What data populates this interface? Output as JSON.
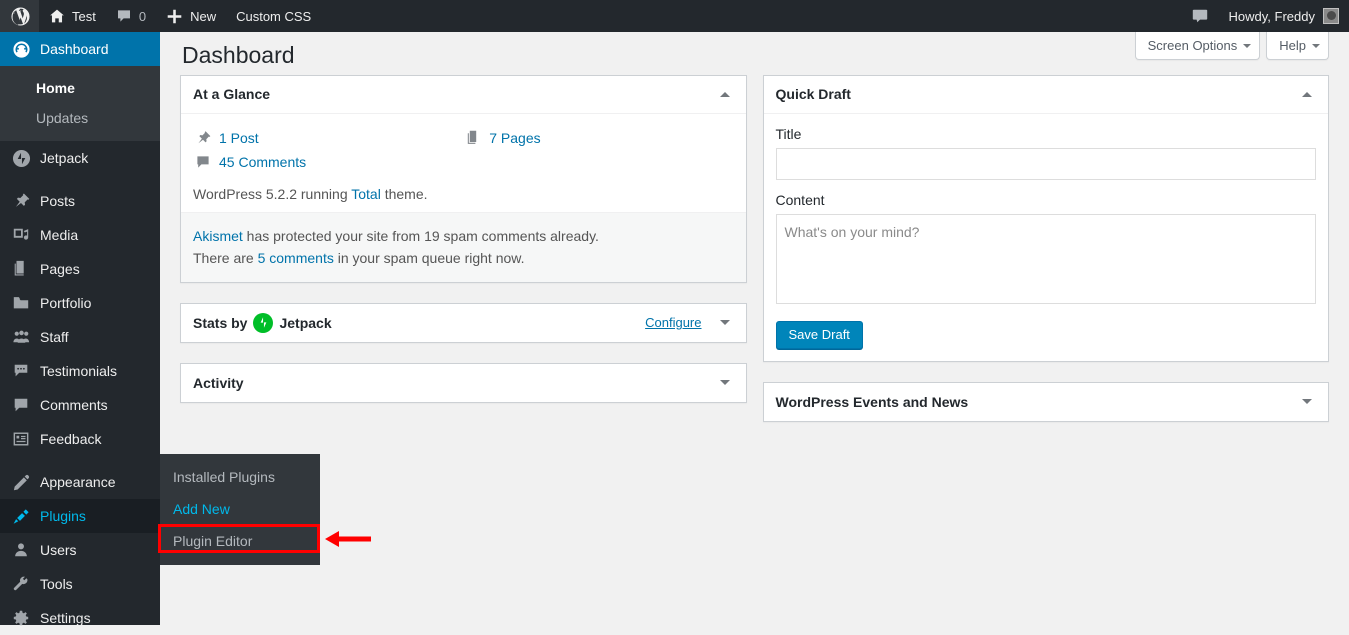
{
  "adminbar": {
    "wp_logo": "wordpress-logo-icon",
    "site_name": "Test",
    "comments_icon": "comment-icon",
    "comments_count": "0",
    "new_label": "New",
    "new_icon": "plus-icon",
    "custom_css": "Custom CSS",
    "notification_icon": "comment-icon",
    "howdy": "Howdy, Freddy",
    "avatar": "user-avatar"
  },
  "sidebar": {
    "items": [
      {
        "label": "Dashboard",
        "icon": "dashboard-icon",
        "state": "current"
      },
      {
        "label": "Jetpack",
        "icon": "jetpack-icon",
        "state": "normal"
      },
      {
        "label": "Posts",
        "icon": "pushpin-icon",
        "state": "normal"
      },
      {
        "label": "Media",
        "icon": "media-icon",
        "state": "normal"
      },
      {
        "label": "Pages",
        "icon": "pages-icon",
        "state": "normal"
      },
      {
        "label": "Portfolio",
        "icon": "portfolio-icon",
        "state": "normal"
      },
      {
        "label": "Staff",
        "icon": "staff-icon",
        "state": "normal"
      },
      {
        "label": "Testimonials",
        "icon": "testimonials-icon",
        "state": "normal"
      },
      {
        "label": "Comments",
        "icon": "comment-icon",
        "state": "normal"
      },
      {
        "label": "Feedback",
        "icon": "feedback-icon",
        "state": "normal"
      },
      {
        "label": "Appearance",
        "icon": "appearance-brush-icon",
        "state": "normal"
      },
      {
        "label": "Plugins",
        "icon": "plugin-icon",
        "state": "hovered"
      },
      {
        "label": "Users",
        "icon": "users-icon",
        "state": "normal"
      },
      {
        "label": "Tools",
        "icon": "tools-wrench-icon",
        "state": "normal"
      },
      {
        "label": "Settings",
        "icon": "settings-gear-icon",
        "state": "normal"
      }
    ],
    "dashboard_submenu": [
      {
        "label": "Home",
        "current": true
      },
      {
        "label": "Updates",
        "current": false
      }
    ]
  },
  "flyout": {
    "items": [
      {
        "label": "Installed Plugins",
        "highlight": false
      },
      {
        "label": "Add New",
        "highlight": true
      },
      {
        "label": "Plugin Editor",
        "highlight": false
      }
    ],
    "annotation_color": "#ff0000"
  },
  "screen_meta": {
    "screen_options": "Screen Options",
    "help": "Help"
  },
  "page": {
    "title": "Dashboard"
  },
  "at_a_glance": {
    "title": "At a Glance",
    "items": [
      {
        "icon": "pushpin-icon",
        "label": "1 Post"
      },
      {
        "icon": "pages-icon",
        "label": "7 Pages"
      },
      {
        "icon": "comment-icon",
        "label": "45 Comments"
      }
    ],
    "version_prefix": "WordPress 5.2.2 running ",
    "theme_name": "Total",
    "version_suffix": " theme.",
    "akismet_link": "Akismet",
    "akismet_line1_rest": " has protected your site from 19 spam comments already.",
    "akismet_line2_prefix": "There are ",
    "akismet_spam_link": "5 comments",
    "akismet_line2_suffix": " in your spam queue right now."
  },
  "jetpack_stats": {
    "prefix": "Stats by",
    "brand": "Jetpack",
    "badge_glyph": "⚡",
    "configure": "Configure"
  },
  "activity": {
    "title": "Activity"
  },
  "quick_draft": {
    "title": "Quick Draft",
    "title_label": "Title",
    "title_value": "",
    "title_placeholder": "",
    "content_label": "Content",
    "content_value": "",
    "content_placeholder": "What's on your mind?",
    "save_button": "Save Draft"
  },
  "events_news": {
    "title": "WordPress Events and News"
  },
  "colors": {
    "admin_bar": "#23282d",
    "menu_background": "#23282d",
    "menu_current": "#0073aa",
    "menu_hover_text": "#00b9eb",
    "submenu_bg": "#32373c",
    "link": "#0073aa",
    "content_bg": "#f1f1f1",
    "jetpack_green": "#00be28",
    "annotation_red": "#ff0000",
    "button_primary": "#0085ba"
  }
}
